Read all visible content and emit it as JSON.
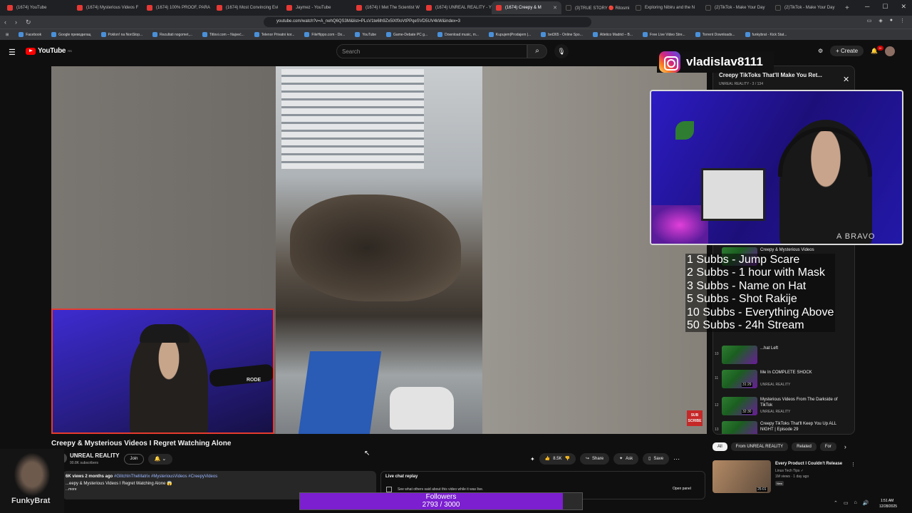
{
  "browser": {
    "tabs": [
      {
        "label": "(1674) YouTube",
        "icon": "youtube-favicon"
      },
      {
        "label": "(1674) Mysterious Videos F",
        "icon": "youtube-favicon"
      },
      {
        "label": "(1674) 100% PROOF, PARA",
        "icon": "youtube-favicon"
      },
      {
        "label": "(1674) Most Convincing Evi",
        "icon": "youtube-favicon"
      },
      {
        "label": "Jaymez - YouTube",
        "icon": "youtube-favicon"
      },
      {
        "label": "(1674) I Met The Scientist W",
        "icon": "youtube-favicon"
      },
      {
        "label": "(1674) UNREAL REALITY - Y",
        "icon": "youtube-favicon"
      },
      {
        "label": "(1674) Creepy & M",
        "icon": "youtube-favicon",
        "active": true
      },
      {
        "label": "(3)TRUE STORY 🔴 Ritosmi",
        "icon": "tiktok-favicon"
      },
      {
        "label": "Exploring Nibiru and the N",
        "icon": "tiktok-favicon"
      },
      {
        "label": "(2)TikTok - Make Your Day",
        "icon": "tiktok-favicon"
      },
      {
        "label": "(2)TikTok - Make Your Day",
        "icon": "tiktok-favicon"
      }
    ],
    "url": "youtube.com/watch?v=A_nehQ6QS3M&list=PLsV1te6lh9Zx5lXf0oVtPPqeSVD5UV4kW&index=3",
    "bookmarks": [
      "Facebook",
      "Google преводилац",
      "Poklon! na NonStop...",
      "Rezultati nogomet,...",
      "Titlovi.com – Najveć...",
      "Telenor Privatni kor...",
      "FileHippo.com - Do...",
      "YouTube",
      "Game-Debate PC g...",
      "Download music, m...",
      "Kupujem|Prodajem |...",
      "bet365 - Online Spo...",
      "Atletico Madrid – B...",
      "Free Live Video Stre...",
      "Torrent Downloads...",
      "funkybrat - Kick Stat..."
    ]
  },
  "youtube": {
    "logo_text": "YouTube",
    "logo_region": "RS",
    "search_placeholder": "Search",
    "create_label": "Create",
    "notif_count": "9+",
    "video_title": "Creepy & Mysterious Videos I Regret Watching Alone",
    "channel_name": "UNREAL REALITY",
    "channel_subs": "90.8K subscribers",
    "join_label": "Join",
    "like_count": "8.5K",
    "share_label": "Share",
    "ask_label": "Ask",
    "save_label": "Save",
    "desc_meta": "6K views  2 months ago",
    "desc_tags": "#GlitchInTheMatrix #MysteriousVideos #CreepyVideos",
    "desc_line": "...eepy & Mysterious Videos I Regret Watching Alone 😱",
    "desc_more": "...more",
    "chat_title": "Live chat replay",
    "chat_sub": "See what others said about this video while it was live.",
    "open_panel": "Open panel",
    "subscribe_badge": "SUB SCRIBE",
    "chips": [
      "All",
      "From UNREAL REALITY",
      "Related",
      "For"
    ],
    "rec": {
      "title": "Every Product I Couldn't Release",
      "channel": "Linus Tech Tips ✓",
      "views": "1M views · 1 day ago",
      "badge": "New",
      "duration": "25:01"
    }
  },
  "playlist": {
    "title": "Creepy TikToks That'll Make You Ret...",
    "sub": "UNREAL REALITY - 3 / 134",
    "items": [
      {
        "num": "",
        "title": "Creepy & Mysterious Videos",
        "channel": "",
        "duration": ""
      },
      {
        "num": "10",
        "title": "...hat Left",
        "channel": "",
        "duration": ""
      },
      {
        "num": "11",
        "title": "Me In COMPLETE SHOCK",
        "channel": "UNREAL REALITY",
        "duration": "31:29"
      },
      {
        "num": "12",
        "title": "Mysterious Videos From The Darkside of TikTok",
        "channel": "UNREAL REALITY",
        "duration": "32:30"
      },
      {
        "num": "13",
        "title": "Creepy TikToks That'll Keep You Up ALL NIGHT | Episode 29",
        "channel": "UNREAL REALITY",
        "duration": "31:48"
      },
      {
        "num": "14",
        "title": "Mysterious Videos You Should",
        "channel": "",
        "duration": ""
      }
    ]
  },
  "overlay": {
    "instagram_handle": "vladislav8111",
    "cam_brand": "A BRAVO",
    "cam_mic_brand": "RODE",
    "sub_goals": [
      "1 Subbs - Jump Scare",
      "2 Subbs - 1 hour with Mask",
      "3 Subbs - Name on Hat",
      "5 Subbs - Shot Rakije",
      "10 Subbs - Everything Above",
      "50 Subbs - 24h Stream"
    ],
    "followers_label": "Followers",
    "followers_count": "2793 / 3000",
    "followers_progress": 0.931,
    "streamer_name": "FunkyBrat"
  },
  "taskbar": {
    "time": "1:51 AM",
    "date": "12/28/2025"
  },
  "colors": {
    "accent": "#ff0000",
    "progress": "#7b1fd0",
    "cam_border": "#e63b2e"
  }
}
